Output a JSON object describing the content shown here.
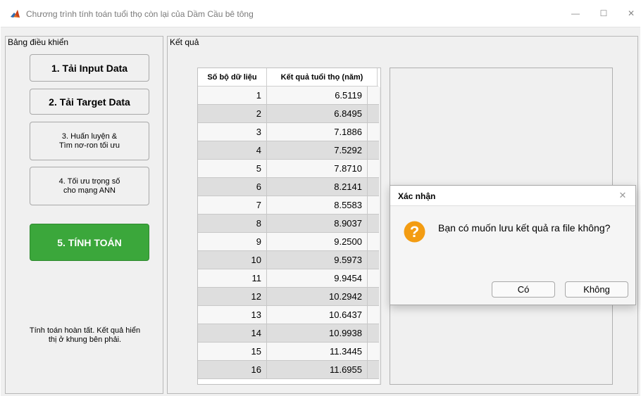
{
  "window": {
    "title": "Chương trình tính toán tuổi thọ còn lại của Dầm Cầu bê tông",
    "icon": "matlab-icon",
    "minimize_glyph": "—",
    "maximize_glyph": "☐",
    "close_glyph": "✕"
  },
  "control_panel": {
    "title": "Bảng điều khiển",
    "buttons": {
      "load_input": "1. Tải Input Data",
      "load_target": "2. Tải Target Data",
      "train_line1": "3. Huấn luyện &",
      "train_line2": "Tìm nơ-ron tối ưu",
      "optimize_line1": "4. Tối ưu trọng số",
      "optimize_line2": "cho mạng ANN",
      "compute": "5. TÍNH TOÁN"
    },
    "status_line1": "Tính toán hoàn tất. Kết quả hiển",
    "status_line2": "thị ở khung bên phải.",
    "compute_color": "#3ba73b"
  },
  "results_panel": {
    "title": "Kết quả",
    "table": {
      "columns": [
        "Số bộ dữ liệu",
        "Kết quả tuổi thọ (năm)"
      ],
      "rows": [
        [
          "1",
          "6.5119"
        ],
        [
          "2",
          "6.8495"
        ],
        [
          "3",
          "7.1886"
        ],
        [
          "4",
          "7.5292"
        ],
        [
          "5",
          "7.8710"
        ],
        [
          "6",
          "8.2141"
        ],
        [
          "7",
          "8.5583"
        ],
        [
          "8",
          "8.9037"
        ],
        [
          "9",
          "9.2500"
        ],
        [
          "10",
          "9.5973"
        ],
        [
          "11",
          "9.9454"
        ],
        [
          "12",
          "10.2942"
        ],
        [
          "13",
          "10.6437"
        ],
        [
          "14",
          "10.9938"
        ],
        [
          "15",
          "11.3445"
        ],
        [
          "16",
          "11.6955"
        ]
      ]
    }
  },
  "dialog": {
    "title": "Xác nhận",
    "message": "Bạn có muốn lưu kết quả ra file không?",
    "icon": "question-icon",
    "icon_color": "#f39c12",
    "yes_label": "Có",
    "no_label": "Không",
    "close_glyph": "✕"
  }
}
